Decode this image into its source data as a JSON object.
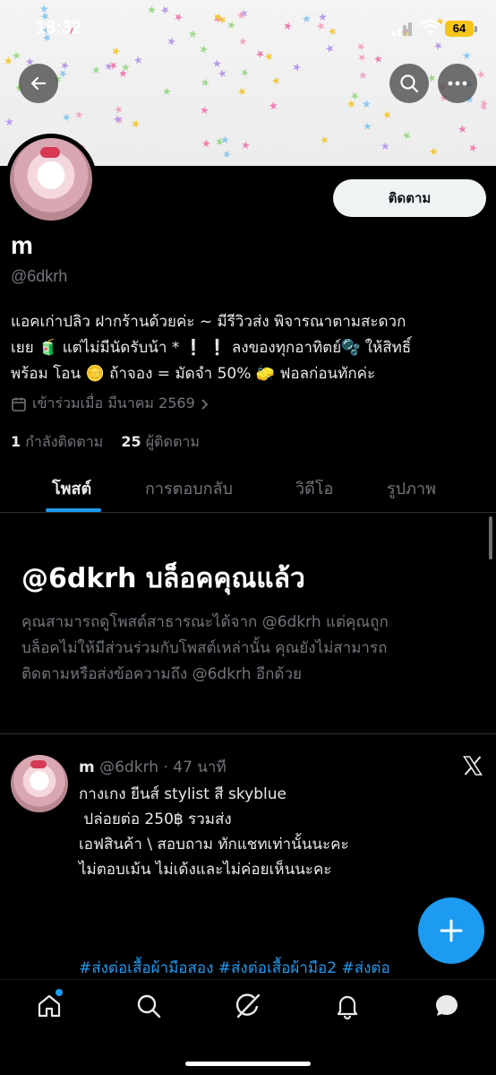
{
  "status_bar": {
    "time": "18:32",
    "battery": "64"
  },
  "profile": {
    "display_name": "m",
    "handle": "@6dkrh",
    "follow_label": "ติดตาม",
    "bio_lines": [
      "แอคเก่าปลิว ฝากร้านด้วยค่ะ ~ มีรีวิวส่ง พิจารณาตามสะดวก",
      "เยย 🧃 แต่ไม่มีนัดรับน้า * ❕ ❕ ลงของทุกอาทิตย์🫧 ให้สิทธิ์",
      "พร้อม โอน 🪙 ถ้าจอง = มัดจำ 50% 🧽 ฟอลก่อนทักค่ะ"
    ],
    "joined": "เข้าร่วมเมื่อ มีนาคม 2569",
    "following_count": "1",
    "following_label": "กำลังติดตาม",
    "followers_count": "25",
    "followers_label": "ผู้ติดตาม"
  },
  "tabs": [
    {
      "label": "โพสต์",
      "active": true
    },
    {
      "label": "การตอบกลับ",
      "active": false
    },
    {
      "label": "วิดีโอ",
      "active": false
    },
    {
      "label": "รูปภาพ",
      "active": false
    }
  ],
  "blocked": {
    "title": "@6dkrh บล็อคคุณแล้ว",
    "desc_lines": [
      "คุณสามารถดูโพสต์สาธารณะได้จาก @6dkrh แต่คุณถูก",
      "บล็อคไม่ให้มีส่วนร่วมกับโพสต์เหล่านั้น คุณยังไม่สามารถ",
      "ติดตามหรือส่งข้อความถึง @6dkrh อีกด้วย"
    ]
  },
  "post": {
    "name": "m",
    "handle": "@6dkrh",
    "time": "· 47 นาที",
    "lines": [
      "กางเกง ยีนส์ stylist สี skyblue",
      "",
      " ปล่อยต่อ 250฿ รวมส่ง",
      "",
      "เอฟสินค้า \\ สอบถาม ทักแชทเท่านั้นนะคะ",
      "ไม่ตอบเม้น ไม่เด้งและไม่ค่อยเห็นนะคะ"
    ],
    "hashtags": "#ส่งต่อเสื้อผ้ามือสอง #ส่งต่อเสื้อผ้ามือ2 #ส่งต่อ"
  },
  "colors": {
    "accent": "#1d9bf0",
    "background": "#000000",
    "muted": "#71767b"
  },
  "icons": {
    "back": "arrow-left-icon",
    "search": "search-icon",
    "more": "more-icon",
    "x": "x-logo-icon",
    "compose": "plus-icon",
    "calendar": "calendar-icon",
    "nav": [
      "home-icon",
      "search-icon",
      "grok-icon",
      "bell-icon",
      "messages-icon"
    ]
  }
}
